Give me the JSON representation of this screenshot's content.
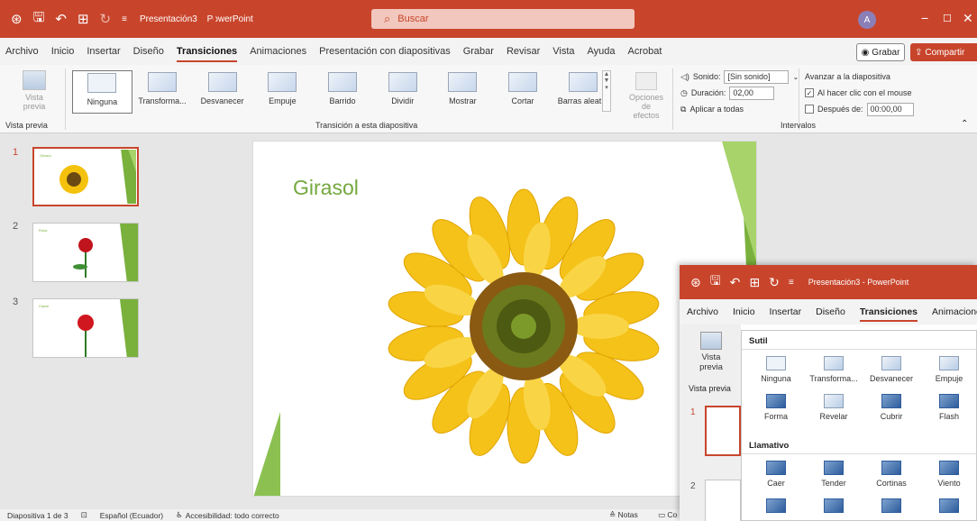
{
  "titlebar": {
    "doc_name": "Presentación3",
    "app_name": "PowerPoint",
    "search_placeholder": "Buscar",
    "avatar_initial": "A",
    "minimize": "−",
    "maximize": "☐",
    "close": "✕"
  },
  "menu": {
    "tabs": [
      "Archivo",
      "Inicio",
      "Insertar",
      "Diseño",
      "Transiciones",
      "Animaciones",
      "Presentación con diapositivas",
      "Grabar",
      "Revisar",
      "Vista",
      "Ayuda",
      "Acrobat"
    ],
    "active_tab": "Transiciones",
    "grabar_label": "Grabar",
    "share_label": "Compartir"
  },
  "ribbon": {
    "preview_label_1": "Vista",
    "preview_label_2": "previa",
    "preview_group": "Vista previa",
    "transitions": [
      "Ninguna",
      "Transforma...",
      "Desvanecer",
      "Empuje",
      "Barrido",
      "Dividir",
      "Mostrar",
      "Cortar",
      "Barras aleat..."
    ],
    "selected_transition": "Ninguna",
    "effect_options_1": "Opciones de",
    "effect_options_2": "efectos",
    "group_transition": "Transición a esta diapositiva",
    "sound_label": "Sonido:",
    "sound_value": "[Sin sonido]",
    "duration_label": "Duración:",
    "duration_value": "02,00",
    "apply_all": "Aplicar a todas",
    "advance_title": "Avanzar a la diapositiva",
    "on_click": "Al hacer clic con el mouse",
    "on_click_checked": true,
    "after_label": "Después de:",
    "after_value": "00:00,00",
    "group_timing": "Intervalos"
  },
  "thumbnails": {
    "numbers": [
      "1",
      "2",
      "3"
    ],
    "titles": [
      "Girasol",
      "Rosa",
      "Clavel"
    ]
  },
  "slide": {
    "title": "Girasol"
  },
  "status": {
    "slide_info": "Diapositiva 1 de 3",
    "language": "Español (Ecuador)",
    "accessibility": "Accesibilidad: todo correcto",
    "notes": "Notas",
    "comments": "Co"
  },
  "overlay": {
    "doc_title": "Presentación3 - PowerPoint",
    "tabs": [
      "Archivo",
      "Inicio",
      "Insertar",
      "Diseño",
      "Transiciones",
      "Animaciones"
    ],
    "active_tab": "Transiciones",
    "preview_1": "Vista",
    "preview_2": "previa",
    "preview_group": "Vista previa",
    "slide_num_1": "1",
    "slide_num_2": "2",
    "section_subtle": "Sutil",
    "subtle_row1": [
      "Ninguna",
      "Transforma...",
      "Desvanecer",
      "Empuje"
    ],
    "subtle_row2": [
      "Forma",
      "Revelar",
      "Cubrir",
      "Flash"
    ],
    "section_exciting": "Llamativo",
    "exciting_row1": [
      "Caer",
      "Tender",
      "Cortinas",
      "Viento"
    ]
  },
  "colors": {
    "accent": "#c8452c",
    "slide_green": "#74a83f"
  }
}
